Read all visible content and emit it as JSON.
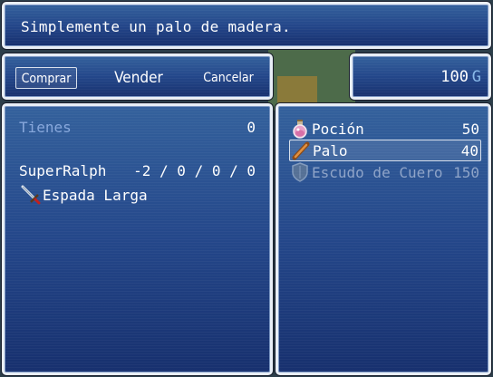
{
  "help": {
    "text": "Simplemente un palo de madera."
  },
  "commands": {
    "buy": "Comprar",
    "sell": "Vender",
    "cancel": "Cancelar",
    "selected": "buy"
  },
  "gold": {
    "value": "100",
    "unit": "G"
  },
  "status": {
    "possession_label": "Tienes",
    "possession_value": "0",
    "actor": {
      "name": "SuperRalph",
      "params": "-2 / 0 / 0 / 0"
    },
    "equipment": {
      "icon": "sword-icon",
      "name": "Espada Larga"
    }
  },
  "shop_items": [
    {
      "name": "Poción",
      "price": "50",
      "icon": "potion-icon",
      "enabled": true
    },
    {
      "name": "Palo",
      "price": "40",
      "icon": "club-icon",
      "enabled": true,
      "selected": true
    },
    {
      "name": "Escudo de Cuero",
      "price": "150",
      "icon": "shield-icon",
      "enabled": false
    }
  ]
}
